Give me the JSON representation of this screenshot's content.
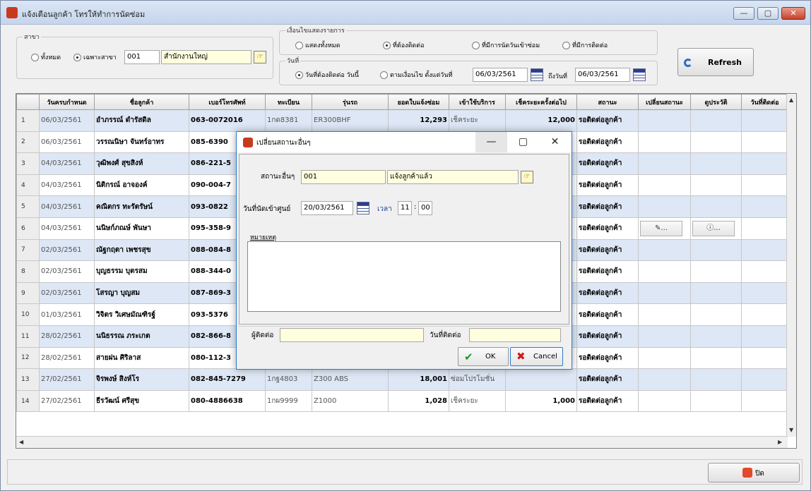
{
  "window": {
    "title": "แจ้งเตือนลูกค้า โทรให้ทำการนัดซ่อม",
    "controls": {
      "minimize": "—",
      "maximize": "▢",
      "close": "✕"
    }
  },
  "branch_group": {
    "legend": "สาขา",
    "radio_all": "ทั้งหมด",
    "radio_only": "เฉพาะสาขา",
    "code": "001",
    "name": "สำนักงานใหญ่"
  },
  "display_group": {
    "legend": "เงื่อนไขแสดงรายการ",
    "options": [
      "แสดงทั้งหมด",
      "ที่ต้องติดต่อ",
      "ที่มีการนัดวันเข้าซ่อม",
      "ที่มีการติดต่อ"
    ],
    "selected_index": 1
  },
  "date_group": {
    "legend": "วันที่",
    "radio_today": "วันที่ต้องติดต่อ วันนี้",
    "radio_range": "ตามเงื่อนไข ตั้งแต่วันที่",
    "date_from": "06/03/2561",
    "to_label": "ถึงวันที่",
    "date_to": "06/03/2561"
  },
  "toolbar": {
    "refresh_label": "Refresh",
    "close_label": "ปิด"
  },
  "grid": {
    "columns": [
      "วันครบกำหนด",
      "ชื่อลูกค้า",
      "เบอร์โทรศัพท์",
      "ทะเบียน",
      "รุ่นรถ",
      "ยอดใบแจ้งซ่อม",
      "เข้าใช้บริการ",
      "เช็คระยะครั้งต่อไป",
      "สถานะ",
      "เปลี่ยนสถานะ",
      "ดูประวัติ",
      "วันที่ติดต่อ"
    ],
    "rows": [
      {
        "n": "1",
        "date": "06/03/2561",
        "name": "อำภรรณ์ ดำรัสดิล",
        "phone": "063-0072016",
        "plate": "1กด8381",
        "model": "ER300BHF",
        "amount": "12,293",
        "service": "เช็คระยะ",
        "next": "12,000",
        "status": "รอติดต่อลูกค้า"
      },
      {
        "n": "2",
        "date": "06/03/2561",
        "name": "วรรณนิษา จันทร์อาทร",
        "phone": "085-6390",
        "plate": "",
        "model": "",
        "amount": "",
        "service": "",
        "next": "",
        "status": "รอติดต่อลูกค้า"
      },
      {
        "n": "3",
        "date": "04/03/2561",
        "name": "วุฒิพงศ์ สุขสิงห์",
        "phone": "086-221-5",
        "plate": "",
        "model": "",
        "amount": "",
        "service": "",
        "next": "",
        "status": "รอติดต่อลูกค้า"
      },
      {
        "n": "4",
        "date": "04/03/2561",
        "name": "นิติกรณ์ อาจองค์",
        "phone": "090-004-7",
        "plate": "",
        "model": "",
        "amount": "",
        "service": "",
        "next": "",
        "status": "รอติดต่อลูกค้า"
      },
      {
        "n": "5",
        "date": "04/03/2561",
        "name": "คณิตกร ทะรัตรัษน์",
        "phone": "093-0822",
        "plate": "",
        "model": "",
        "amount": "",
        "service": "",
        "next": "",
        "status": "รอติดต่อลูกค้า"
      },
      {
        "n": "6",
        "date": "04/03/2561",
        "name": "นนิษก์ภณษ์ พันษา",
        "phone": "095-358-9",
        "plate": "",
        "model": "",
        "amount": "",
        "service": "",
        "next": "",
        "status": "รอติดต่อลูกค้า"
      },
      {
        "n": "7",
        "date": "02/03/2561",
        "name": "ณัฐกฤตา เพชรสุข",
        "phone": "088-084-8",
        "plate": "",
        "model": "",
        "amount": "",
        "service": "",
        "next": "",
        "status": "รอติดต่อลูกค้า"
      },
      {
        "n": "8",
        "date": "02/03/2561",
        "name": "บุญธรรม บุตรสม",
        "phone": "088-344-0",
        "plate": "",
        "model": "",
        "amount": "",
        "service": "",
        "next": "",
        "status": "รอติดต่อลูกค้า"
      },
      {
        "n": "9",
        "date": "02/03/2561",
        "name": "โสรญา บุญสม",
        "phone": "087-869-3",
        "plate": "",
        "model": "",
        "amount": "",
        "service": "",
        "next": "",
        "status": "รอติดต่อลูกค้า"
      },
      {
        "n": "10",
        "date": "01/03/2561",
        "name": "วิจิตร วิเศษมัณฑิรฐ์",
        "phone": "093-5376",
        "plate": "",
        "model": "",
        "amount": "",
        "service": "",
        "next": "",
        "status": "รอติดต่อลูกค้า"
      },
      {
        "n": "11",
        "date": "28/02/2561",
        "name": "นนิธรรณ ภระเกต",
        "phone": "082-866-8",
        "plate": "",
        "model": "",
        "amount": "",
        "service": "",
        "next": "",
        "status": "รอติดต่อลูกค้า"
      },
      {
        "n": "12",
        "date": "28/02/2561",
        "name": "สายฝน ศิริลาส",
        "phone": "080-112-3",
        "plate": "",
        "model": "",
        "amount": "",
        "service": "",
        "next": "",
        "status": "รอติดต่อลูกค้า"
      },
      {
        "n": "13",
        "date": "27/02/2561",
        "name": "จิรพงษ์ สิงห์โร",
        "phone": "082-845-7279",
        "plate": "1กฐ4803",
        "model": "Z300 ABS",
        "amount": "18,001",
        "service": "ซ่อมโปรโมชั่น",
        "next": "",
        "status": "รอติดต่อลูกค้า"
      },
      {
        "n": "14",
        "date": "27/02/2561",
        "name": "ธีรวัฒน์ ศรีสุข",
        "phone": "080-4886638",
        "plate": "1กผ9999",
        "model": "Z1000",
        "amount": "1,028",
        "service": "เช็คระยะ",
        "next": "1,000",
        "status": "รอติดต่อลูกค้า"
      }
    ],
    "row6_change_icon": "✎",
    "row6_history_icon": "ⓘ",
    "row6_btn_suffix": "..."
  },
  "dialog": {
    "title": "เปลี่ยนสถานะอื่นๆ",
    "status_label": "สถานะอื่นๆ",
    "status_code": "001",
    "status_name": "แจ้งลูกค้าแล้ว",
    "appt_label": "วันที่นัดเข้าศูนย์",
    "appt_date": "20/03/2561",
    "time_label": "เวลา",
    "hour": "11",
    "minute": "00",
    "time_sep": ":",
    "note_label": "หมายเหตุ",
    "contact_label": "ผู้ติดต่อ",
    "contact_date_label": "วันที่ติดต่อ",
    "ok_label": "OK",
    "cancel_label": "Cancel"
  }
}
